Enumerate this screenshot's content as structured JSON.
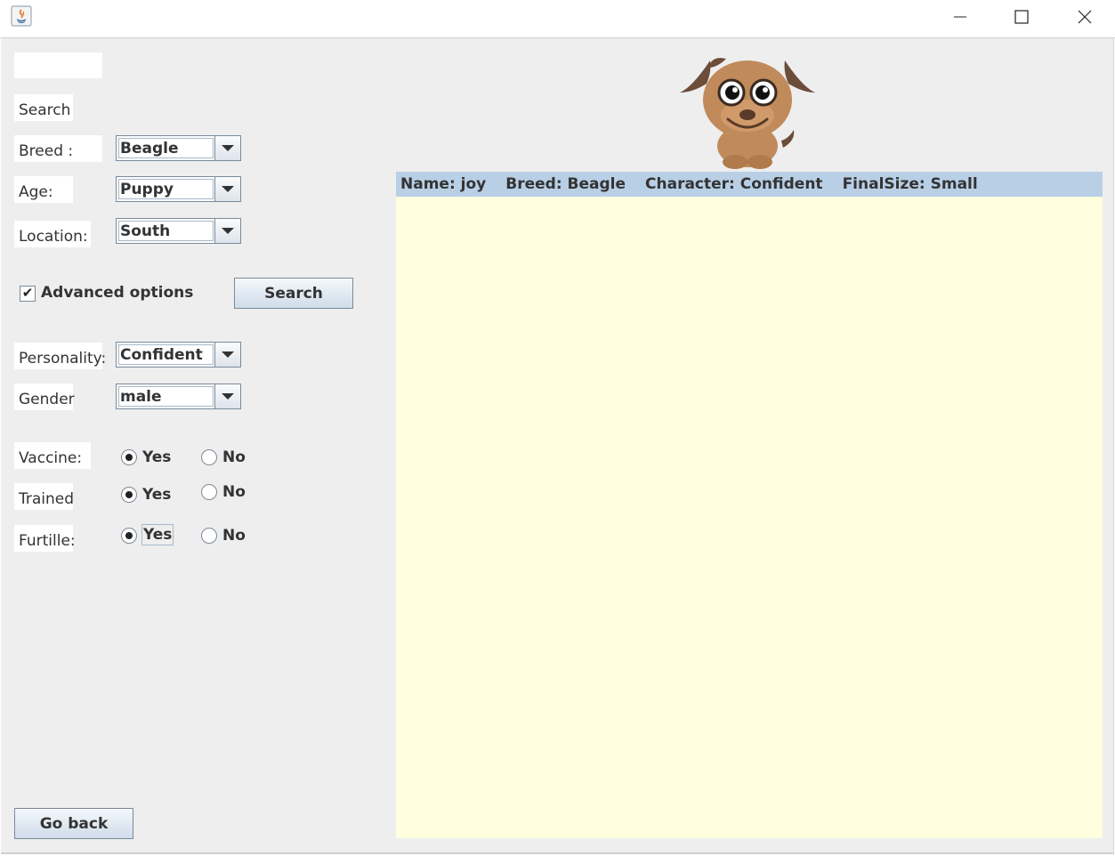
{
  "window": {
    "title": ""
  },
  "top_field": {
    "value": ""
  },
  "search_heading": "Search",
  "filters": [
    {
      "label": "Breed :",
      "value": "Beagle"
    },
    {
      "label": "Age:",
      "value": "Puppy"
    },
    {
      "label": "Location:",
      "value": "South"
    }
  ],
  "advanced": {
    "label": "Advanced options",
    "checked": true
  },
  "search_button": "Search",
  "advanced_filters": [
    {
      "label": "Personality:",
      "value": "Confident"
    },
    {
      "label": "Gender",
      "value": "male"
    }
  ],
  "radio_groups": [
    {
      "label": "Vaccine:",
      "yes": "Yes",
      "no": "No",
      "selected": "Yes"
    },
    {
      "label": "Trained",
      "yes": "Yes",
      "no": "No",
      "selected": "Yes"
    },
    {
      "label": "Furtille:",
      "yes": "Yes",
      "no": "No",
      "selected": "Yes"
    }
  ],
  "go_back_button": "Go back",
  "result": {
    "name": "Name: joy",
    "breed": "Breed: Beagle",
    "character": "Character: Confident",
    "final_size": "FinalSize: Small"
  },
  "colors": {
    "result_row_bg": "#b8cfe6",
    "result_panel_bg": "#fffedf",
    "panel_bg": "#eeeeee",
    "dog_fur": "#c08a5a",
    "dog_ears": "#6b4d3a"
  },
  "icons": [
    "java-app-icon",
    "minimize-icon",
    "maximize-icon",
    "close-icon",
    "dog-illustration",
    "check-icon",
    "chevron-down-icon"
  ]
}
